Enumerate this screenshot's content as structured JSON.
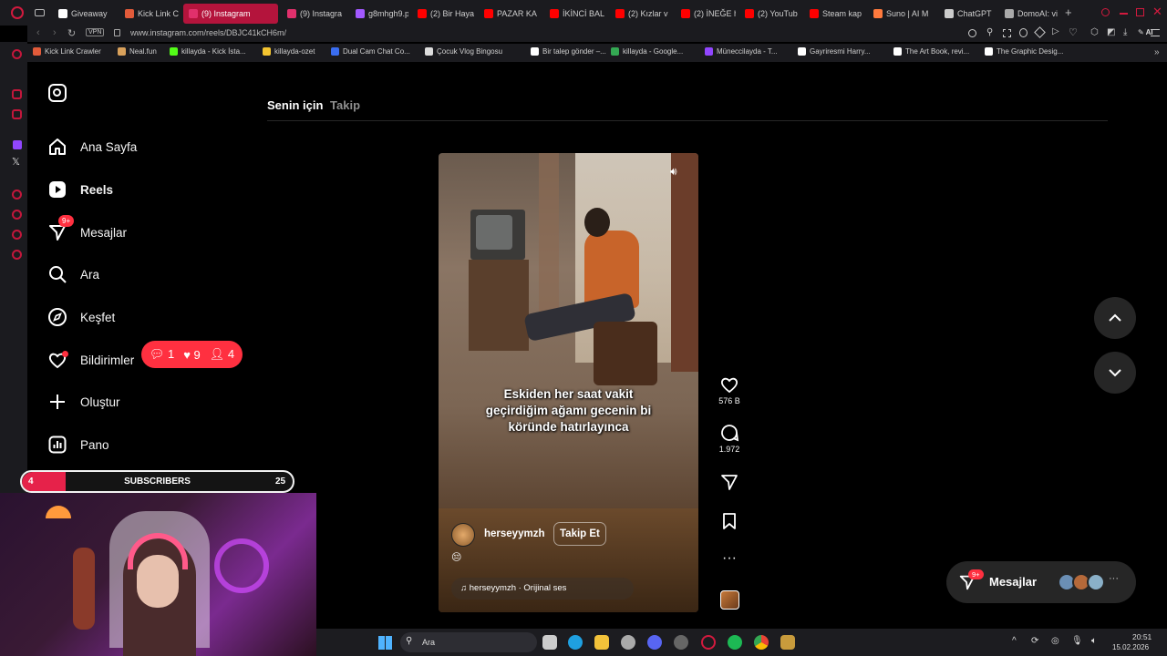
{
  "browser": {
    "tabs": [
      {
        "label": "Giveaway",
        "color": "#ffffff",
        "active": false
      },
      {
        "label": "Kick Link C",
        "color": "#e25b3a",
        "active": false
      },
      {
        "label": "(9) Instagram",
        "color": "#e1306c",
        "active": true
      },
      {
        "label": "(9) Instagra",
        "color": "#e1306c",
        "active": false
      },
      {
        "label": "g8mhgh9.p",
        "color": "#a259ff",
        "active": false
      },
      {
        "label": "(2) Bir Haya",
        "color": "#ff0000",
        "active": false
      },
      {
        "label": "PAZAR KA",
        "color": "#ff0000",
        "active": false
      },
      {
        "label": "İKİNCİ BAL",
        "color": "#ff0000",
        "active": false
      },
      {
        "label": "(2) Kızlar v",
        "color": "#ff0000",
        "active": false
      },
      {
        "label": "(2) İNEĞE h",
        "color": "#ff0000",
        "active": false
      },
      {
        "label": "(2) YouTub",
        "color": "#ff0000",
        "active": false
      },
      {
        "label": "Steam kap",
        "color": "#ff0000",
        "active": false
      },
      {
        "label": "Suno | AI M",
        "color": "#ff7a3d",
        "active": false
      },
      {
        "label": "ChatGPT",
        "color": "#cccccc",
        "active": false
      },
      {
        "label": "DomoAI: vi",
        "color": "#aaaaaa",
        "active": false
      }
    ],
    "vpn_label": "VPN",
    "url": "www.instagram.com/reels/DBJC41kCH6m/",
    "ai_label": "AI",
    "bookmarks": [
      {
        "label": "Kick Link Crawler",
        "color": "#e25b3a"
      },
      {
        "label": "Neal.fun",
        "color": "#d9a15b"
      },
      {
        "label": "killayda - Kick İsta...",
        "color": "#53fc18"
      },
      {
        "label": "killayda-ozet",
        "color": "#f4c430"
      },
      {
        "label": "Dual Cam Chat Co...",
        "color": "#3a6df0"
      },
      {
        "label": "Çocuk Vlog Bingosu",
        "color": "#dddddd"
      },
      {
        "label": "Bir talep gönder –...",
        "color": "#ffffff"
      },
      {
        "label": "killayda - Google...",
        "color": "#34a853"
      },
      {
        "label": "Müneccilayda - T...",
        "color": "#9146ff"
      },
      {
        "label": "Gayriresmi Harry...",
        "color": "#ffffff"
      },
      {
        "label": "The Art Book, revi...",
        "color": "#ffffff"
      },
      {
        "label": "The Graphic Desig...",
        "color": "#ffffff"
      }
    ]
  },
  "sidebar": {
    "items": [
      {
        "label": "Ana Sayfa",
        "icon": "home-icon"
      },
      {
        "label": "Reels",
        "icon": "reels-icon"
      },
      {
        "label": "Mesajlar",
        "icon": "messenger-icon",
        "badge": "9+"
      },
      {
        "label": "Ara",
        "icon": "search-icon"
      },
      {
        "label": "Keşfet",
        "icon": "compass-icon"
      },
      {
        "label": "Bildirimler",
        "icon": "heart-icon"
      },
      {
        "label": "Oluştur",
        "icon": "plus-icon"
      },
      {
        "label": "Pano",
        "icon": "dashboard-icon"
      }
    ]
  },
  "notifications_pill": {
    "comments": "1",
    "likes": "9",
    "follows": "4"
  },
  "feed": {
    "tab_for_you": "Senin için",
    "tab_following": "Takip"
  },
  "reel": {
    "caption": "Eskiden her saat vakit geçirdiğim ağamı gecenin bi köründe hatırlayınca",
    "username": "herseyymzh",
    "follow_label": "Takip Et",
    "emoji": "😔",
    "audio": "herseyymzh · Orijinal ses",
    "likes": "576 B",
    "comments": "1.972"
  },
  "messages_pill": {
    "label": "Mesajlar",
    "badge": "9+"
  },
  "overlay": {
    "subs_left": "4",
    "subs_label": "SUBSCRIBERS",
    "subs_right": "25",
    "subs_progress": 0.16
  },
  "taskbar": {
    "search_placeholder": "Ara",
    "time": "20:51",
    "date": "15.02.2026"
  }
}
